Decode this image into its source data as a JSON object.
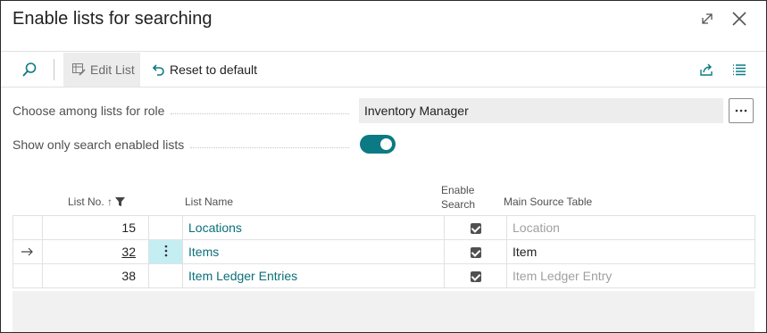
{
  "dialog": {
    "title": "Enable lists for searching"
  },
  "toolbar": {
    "edit_list_label": "Edit List",
    "reset_label": "Reset to default"
  },
  "fields": {
    "role_label": "Choose among lists for role",
    "role_value": "Inventory Manager",
    "show_only_label": "Show only search enabled lists",
    "show_only_enabled": true
  },
  "columns": {
    "list_no": "List No.",
    "list_name": "List Name",
    "enable_search_line1": "Enable",
    "enable_search_line2": "Search",
    "main_source_table": "Main Source Table"
  },
  "rows": [
    {
      "list_no": "15",
      "name": "Locations",
      "enabled": true,
      "source": "Location",
      "selected": false
    },
    {
      "list_no": "32",
      "name": "Items",
      "enabled": true,
      "source": "Item",
      "selected": true
    },
    {
      "list_no": "38",
      "name": "Item Ledger Entries",
      "enabled": true,
      "source": "Item Ledger Entry",
      "selected": false
    }
  ],
  "colors": {
    "accent": "#0b7a84",
    "link": "#0b6f7a",
    "selected_menu": "#c4eef2"
  }
}
